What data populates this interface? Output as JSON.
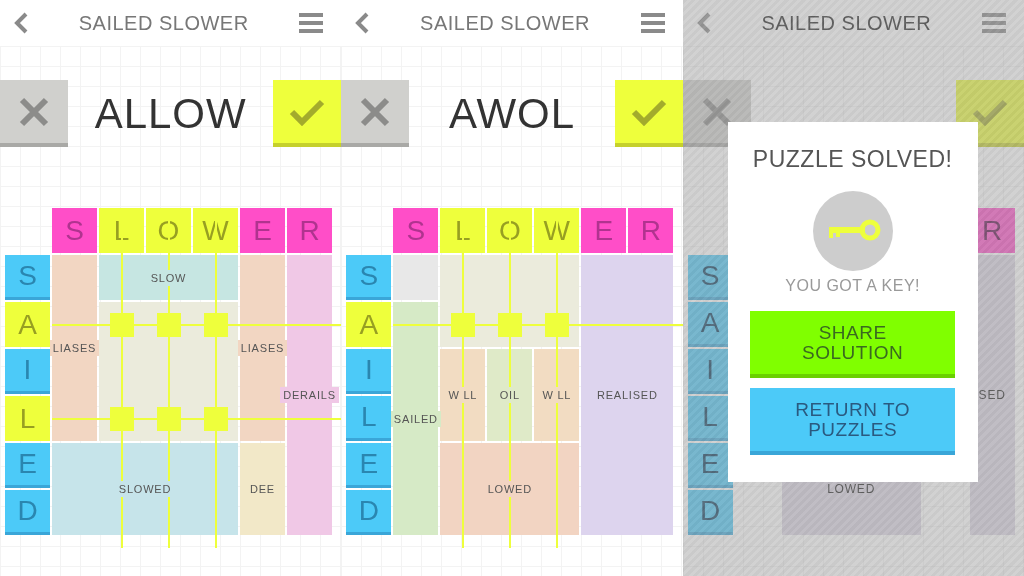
{
  "panels": [
    {
      "title": "SAILED SLOWER",
      "word": "ALLOW",
      "board": {
        "columns": [
          {
            "letter": "S",
            "highlighted": false
          },
          {
            "letter": "L",
            "highlighted": true
          },
          {
            "letter": "O",
            "highlighted": true
          },
          {
            "letter": "W",
            "highlighted": true
          },
          {
            "letter": "E",
            "highlighted": false
          },
          {
            "letter": "R",
            "highlighted": false
          }
        ],
        "rows": [
          {
            "letter": "S",
            "highlighted": false
          },
          {
            "letter": "A",
            "highlighted": true
          },
          {
            "letter": "I",
            "highlighted": false
          },
          {
            "letter": "L",
            "highlighted": true
          },
          {
            "letter": "E",
            "highlighted": false
          },
          {
            "letter": "D",
            "highlighted": false
          }
        ],
        "blocks": [
          {
            "word": "LIASES",
            "color": "#f2d6c2"
          },
          {
            "word": "SLOW",
            "color": "#c6e6e2"
          },
          {
            "color": "#ebebdc"
          },
          {
            "word": "LIASES",
            "color": "#f2d6c2"
          },
          {
            "word": "DERAILS",
            "color": "#f0c8e6"
          },
          {
            "word": "SLOWED",
            "color": "#c6e4ea"
          },
          {
            "word": "DEE",
            "color": "#f2e8c8"
          }
        ]
      }
    },
    {
      "title": "SAILED SLOWER",
      "word": "AWOL",
      "board": {
        "columns": [
          {
            "letter": "S",
            "highlighted": false
          },
          {
            "letter": "L",
            "highlighted": true
          },
          {
            "letter": "O",
            "highlighted": true
          },
          {
            "letter": "W",
            "highlighted": true
          },
          {
            "letter": "E",
            "highlighted": false
          },
          {
            "letter": "R",
            "highlighted": false
          }
        ],
        "rows": [
          {
            "letter": "S",
            "highlighted": false
          },
          {
            "letter": "A",
            "highlighted": true
          },
          {
            "letter": "I",
            "highlighted": false
          },
          {
            "letter": "L",
            "highlighted": false
          },
          {
            "letter": "E",
            "highlighted": false
          },
          {
            "letter": "D",
            "highlighted": false
          }
        ],
        "blocks": [
          {
            "color": "#e8e8e8"
          },
          {
            "color": "#ebebdc"
          },
          {
            "word": "REALISED",
            "color": "#ddd4ee"
          },
          {
            "word": "SAILED",
            "color": "#d6eac6"
          },
          {
            "word": "W LL",
            "color": "#f2dcc2"
          },
          {
            "word": "OIL",
            "color": "#dfeac8"
          },
          {
            "word": "W LL",
            "color": "#f2dcc2"
          },
          {
            "word": "LOWED",
            "color": "#f2d4c2"
          }
        ]
      }
    },
    {
      "title": "SAILED SLOWER",
      "board": {
        "columns": [
          {
            "letter": "R",
            "highlighted": false
          }
        ],
        "rows": [
          {
            "letter": "S",
            "highlighted": false
          },
          {
            "letter": "A",
            "highlighted": false
          },
          {
            "letter": "I",
            "highlighted": false
          },
          {
            "letter": "L",
            "highlighted": false
          },
          {
            "letter": "E",
            "highlighted": false
          },
          {
            "letter": "D",
            "highlighted": false
          }
        ],
        "blocks": [
          {
            "word": "LOWED"
          },
          {
            "word": "SED"
          }
        ]
      },
      "dialog": {
        "title": "PUZZLE SOLVED!",
        "message": "YOU GOT A KEY!",
        "buttons": [
          {
            "label": "SHARE SOLUTION",
            "kind": "share"
          },
          {
            "label": "RETURN TO PUZZLES",
            "kind": "return"
          }
        ]
      }
    }
  ]
}
